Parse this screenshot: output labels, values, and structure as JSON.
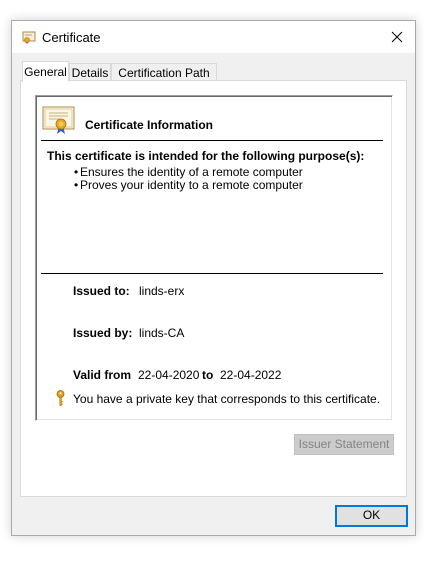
{
  "window": {
    "title": "Certificate"
  },
  "tabs": [
    {
      "label": "General",
      "active": true
    },
    {
      "label": "Details",
      "active": false
    },
    {
      "label": "Certification Path",
      "active": false
    }
  ],
  "cert": {
    "heading": "Certificate Information",
    "purpose_title": "This certificate is intended for the following purpose(s):",
    "purposes": [
      "Ensures the identity of a remote computer",
      "Proves your identity to a remote computer"
    ],
    "issued_to_label": "Issued to:",
    "issued_to": "linds-erx",
    "issued_by_label": "Issued by:",
    "issued_by": "linds-CA",
    "valid_from_label": "Valid from",
    "valid_from": "22-04-2020",
    "valid_to_label": "to",
    "valid_to": "22-04-2022",
    "private_key_note": "You have a private key that corresponds to this certificate."
  },
  "buttons": {
    "issuer_statement": "Issuer Statement",
    "ok": "OK"
  },
  "icons": {
    "title": "certificate-icon",
    "close": "close-icon",
    "cert": "certificate-icon",
    "key": "key-icon"
  },
  "colors": {
    "accent": "#0078d7",
    "disabled_text": "#838383",
    "key_gold": "#e0a020"
  }
}
